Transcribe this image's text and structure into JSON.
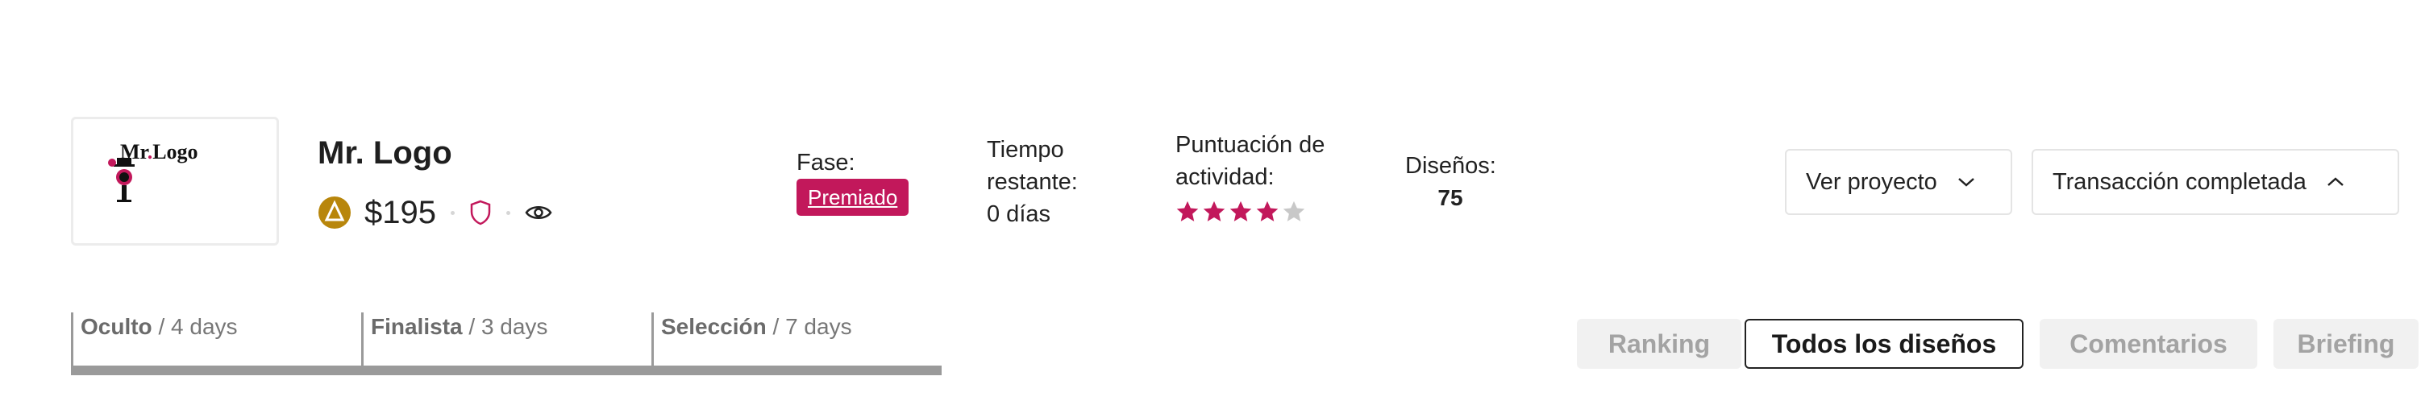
{
  "contest": {
    "title": "Mr. Logo",
    "prize": "$195",
    "logo_text": "Mr.Logo"
  },
  "stats": {
    "fase_label": "Fase:",
    "fase_value": "Premiado",
    "tiempo_label_1": "Tiempo",
    "tiempo_label_2": "restante:",
    "tiempo_value": "0 días",
    "puntuacion_label_1": "Puntuación de",
    "puntuacion_label_2": "actividad:",
    "puntuacion_rating": 4,
    "puntuacion_max": 5,
    "disenos_label": "Diseños:",
    "disenos_value": "75"
  },
  "actions": {
    "ver_proyecto": "Ver proyecto",
    "transaccion": "Transacción completada"
  },
  "phases": [
    {
      "name": "Oculto",
      "sep": "/",
      "duration": "4 days"
    },
    {
      "name": "Finalista",
      "sep": "/",
      "duration": "3 days"
    },
    {
      "name": "Selección",
      "sep": "/",
      "duration": "7 days"
    }
  ],
  "tabs": [
    {
      "label": "Ranking",
      "active": false
    },
    {
      "label": "Todos los diseños",
      "active": true
    },
    {
      "label": "Comentarios",
      "active": false
    },
    {
      "label": "Briefing",
      "active": false
    }
  ],
  "colors": {
    "accent": "#c2185b",
    "medal": "#b8860b",
    "star_empty": "#c8c8c8",
    "phase_bar": "#9a9a9a"
  },
  "icons": [
    "medal-icon",
    "shield-icon",
    "eye-icon",
    "chevron-down-icon",
    "chevron-up-icon",
    "star-icon"
  ]
}
